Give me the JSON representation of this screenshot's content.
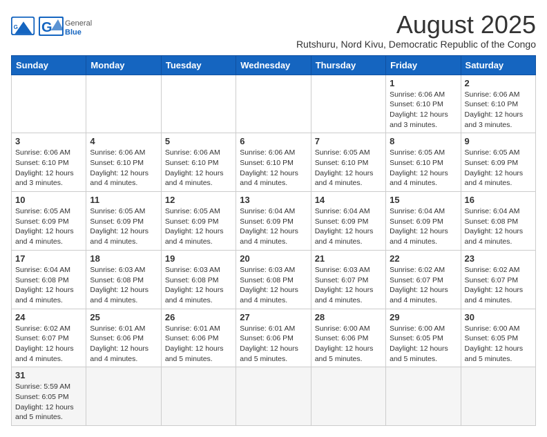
{
  "header": {
    "logo_general": "General",
    "logo_blue": "Blue",
    "title": "August 2025",
    "subtitle": "Rutshuru, Nord Kivu, Democratic Republic of the Congo"
  },
  "weekdays": [
    "Sunday",
    "Monday",
    "Tuesday",
    "Wednesday",
    "Thursday",
    "Friday",
    "Saturday"
  ],
  "weeks": [
    [
      {
        "day": "",
        "info": ""
      },
      {
        "day": "",
        "info": ""
      },
      {
        "day": "",
        "info": ""
      },
      {
        "day": "",
        "info": ""
      },
      {
        "day": "",
        "info": ""
      },
      {
        "day": "1",
        "info": "Sunrise: 6:06 AM\nSunset: 6:10 PM\nDaylight: 12 hours and 3 minutes."
      },
      {
        "day": "2",
        "info": "Sunrise: 6:06 AM\nSunset: 6:10 PM\nDaylight: 12 hours and 3 minutes."
      }
    ],
    [
      {
        "day": "3",
        "info": "Sunrise: 6:06 AM\nSunset: 6:10 PM\nDaylight: 12 hours and 3 minutes."
      },
      {
        "day": "4",
        "info": "Sunrise: 6:06 AM\nSunset: 6:10 PM\nDaylight: 12 hours and 4 minutes."
      },
      {
        "day": "5",
        "info": "Sunrise: 6:06 AM\nSunset: 6:10 PM\nDaylight: 12 hours and 4 minutes."
      },
      {
        "day": "6",
        "info": "Sunrise: 6:06 AM\nSunset: 6:10 PM\nDaylight: 12 hours and 4 minutes."
      },
      {
        "day": "7",
        "info": "Sunrise: 6:05 AM\nSunset: 6:10 PM\nDaylight: 12 hours and 4 minutes."
      },
      {
        "day": "8",
        "info": "Sunrise: 6:05 AM\nSunset: 6:10 PM\nDaylight: 12 hours and 4 minutes."
      },
      {
        "day": "9",
        "info": "Sunrise: 6:05 AM\nSunset: 6:09 PM\nDaylight: 12 hours and 4 minutes."
      }
    ],
    [
      {
        "day": "10",
        "info": "Sunrise: 6:05 AM\nSunset: 6:09 PM\nDaylight: 12 hours and 4 minutes."
      },
      {
        "day": "11",
        "info": "Sunrise: 6:05 AM\nSunset: 6:09 PM\nDaylight: 12 hours and 4 minutes."
      },
      {
        "day": "12",
        "info": "Sunrise: 6:05 AM\nSunset: 6:09 PM\nDaylight: 12 hours and 4 minutes."
      },
      {
        "day": "13",
        "info": "Sunrise: 6:04 AM\nSunset: 6:09 PM\nDaylight: 12 hours and 4 minutes."
      },
      {
        "day": "14",
        "info": "Sunrise: 6:04 AM\nSunset: 6:09 PM\nDaylight: 12 hours and 4 minutes."
      },
      {
        "day": "15",
        "info": "Sunrise: 6:04 AM\nSunset: 6:09 PM\nDaylight: 12 hours and 4 minutes."
      },
      {
        "day": "16",
        "info": "Sunrise: 6:04 AM\nSunset: 6:08 PM\nDaylight: 12 hours and 4 minutes."
      }
    ],
    [
      {
        "day": "17",
        "info": "Sunrise: 6:04 AM\nSunset: 6:08 PM\nDaylight: 12 hours and 4 minutes."
      },
      {
        "day": "18",
        "info": "Sunrise: 6:03 AM\nSunset: 6:08 PM\nDaylight: 12 hours and 4 minutes."
      },
      {
        "day": "19",
        "info": "Sunrise: 6:03 AM\nSunset: 6:08 PM\nDaylight: 12 hours and 4 minutes."
      },
      {
        "day": "20",
        "info": "Sunrise: 6:03 AM\nSunset: 6:08 PM\nDaylight: 12 hours and 4 minutes."
      },
      {
        "day": "21",
        "info": "Sunrise: 6:03 AM\nSunset: 6:07 PM\nDaylight: 12 hours and 4 minutes."
      },
      {
        "day": "22",
        "info": "Sunrise: 6:02 AM\nSunset: 6:07 PM\nDaylight: 12 hours and 4 minutes."
      },
      {
        "day": "23",
        "info": "Sunrise: 6:02 AM\nSunset: 6:07 PM\nDaylight: 12 hours and 4 minutes."
      }
    ],
    [
      {
        "day": "24",
        "info": "Sunrise: 6:02 AM\nSunset: 6:07 PM\nDaylight: 12 hours and 4 minutes."
      },
      {
        "day": "25",
        "info": "Sunrise: 6:01 AM\nSunset: 6:06 PM\nDaylight: 12 hours and 4 minutes."
      },
      {
        "day": "26",
        "info": "Sunrise: 6:01 AM\nSunset: 6:06 PM\nDaylight: 12 hours and 5 minutes."
      },
      {
        "day": "27",
        "info": "Sunrise: 6:01 AM\nSunset: 6:06 PM\nDaylight: 12 hours and 5 minutes."
      },
      {
        "day": "28",
        "info": "Sunrise: 6:00 AM\nSunset: 6:06 PM\nDaylight: 12 hours and 5 minutes."
      },
      {
        "day": "29",
        "info": "Sunrise: 6:00 AM\nSunset: 6:05 PM\nDaylight: 12 hours and 5 minutes."
      },
      {
        "day": "30",
        "info": "Sunrise: 6:00 AM\nSunset: 6:05 PM\nDaylight: 12 hours and 5 minutes."
      }
    ],
    [
      {
        "day": "31",
        "info": "Sunrise: 5:59 AM\nSunset: 6:05 PM\nDaylight: 12 hours and 5 minutes."
      },
      {
        "day": "",
        "info": ""
      },
      {
        "day": "",
        "info": ""
      },
      {
        "day": "",
        "info": ""
      },
      {
        "day": "",
        "info": ""
      },
      {
        "day": "",
        "info": ""
      },
      {
        "day": "",
        "info": ""
      }
    ]
  ]
}
